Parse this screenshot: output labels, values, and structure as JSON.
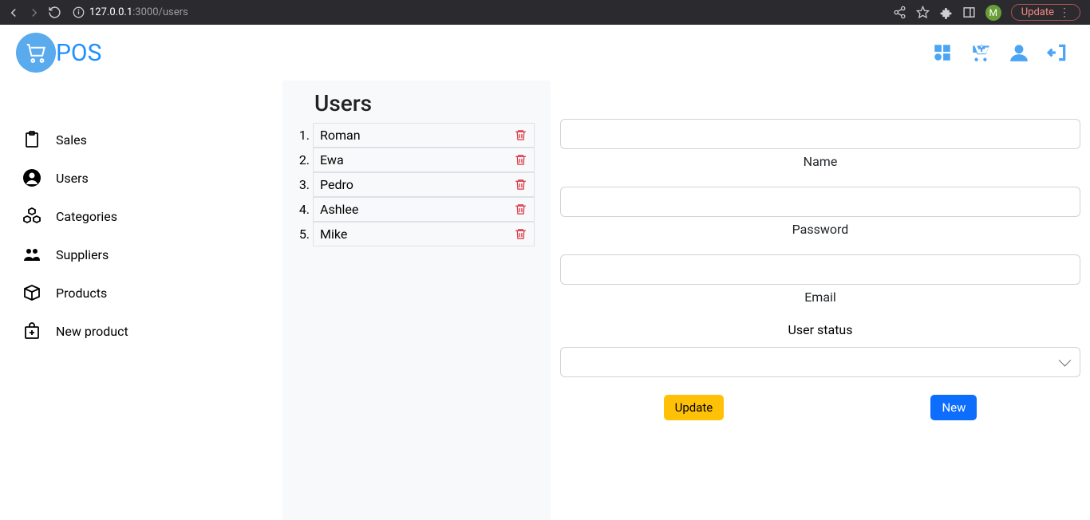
{
  "browser": {
    "url_host": "127.0.0.1",
    "url_path": ":3000/users",
    "profile_initial": "M",
    "update_label": "Update"
  },
  "header": {
    "logo_text": "POS"
  },
  "sidebar": {
    "items": [
      {
        "label": "Sales"
      },
      {
        "label": "Users"
      },
      {
        "label": "Categories"
      },
      {
        "label": "Suppliers"
      },
      {
        "label": "Products"
      },
      {
        "label": "New product"
      }
    ]
  },
  "center": {
    "title": "Users",
    "users": [
      {
        "name": "Roman"
      },
      {
        "name": "Ewa"
      },
      {
        "name": "Pedro"
      },
      {
        "name": "Ashlee"
      },
      {
        "name": "Mike"
      }
    ]
  },
  "form": {
    "name_label": "Name",
    "name_value": "",
    "password_label": "Password",
    "password_value": "",
    "email_label": "Email",
    "email_value": "",
    "status_label": "User status",
    "status_value": "",
    "update_btn": "Update",
    "new_btn": "New"
  }
}
